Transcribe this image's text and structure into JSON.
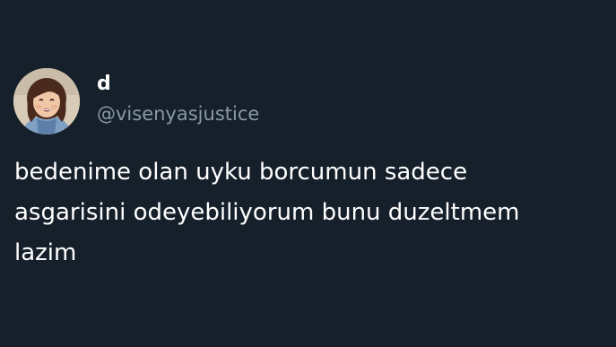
{
  "tweet": {
    "author": {
      "display_name": "d",
      "handle": "@visenyasjustice",
      "avatar_icon": "child-portrait-avatar"
    },
    "text_lines": [
      "bedenime olan uyku borcumun sadece",
      "asgarisini odeyebiliyorum bunu duzeltmem",
      "lazim"
    ]
  },
  "colors": {
    "background": "#16202b",
    "primary_text": "#ffffff",
    "secondary_text": "#8899a6"
  }
}
